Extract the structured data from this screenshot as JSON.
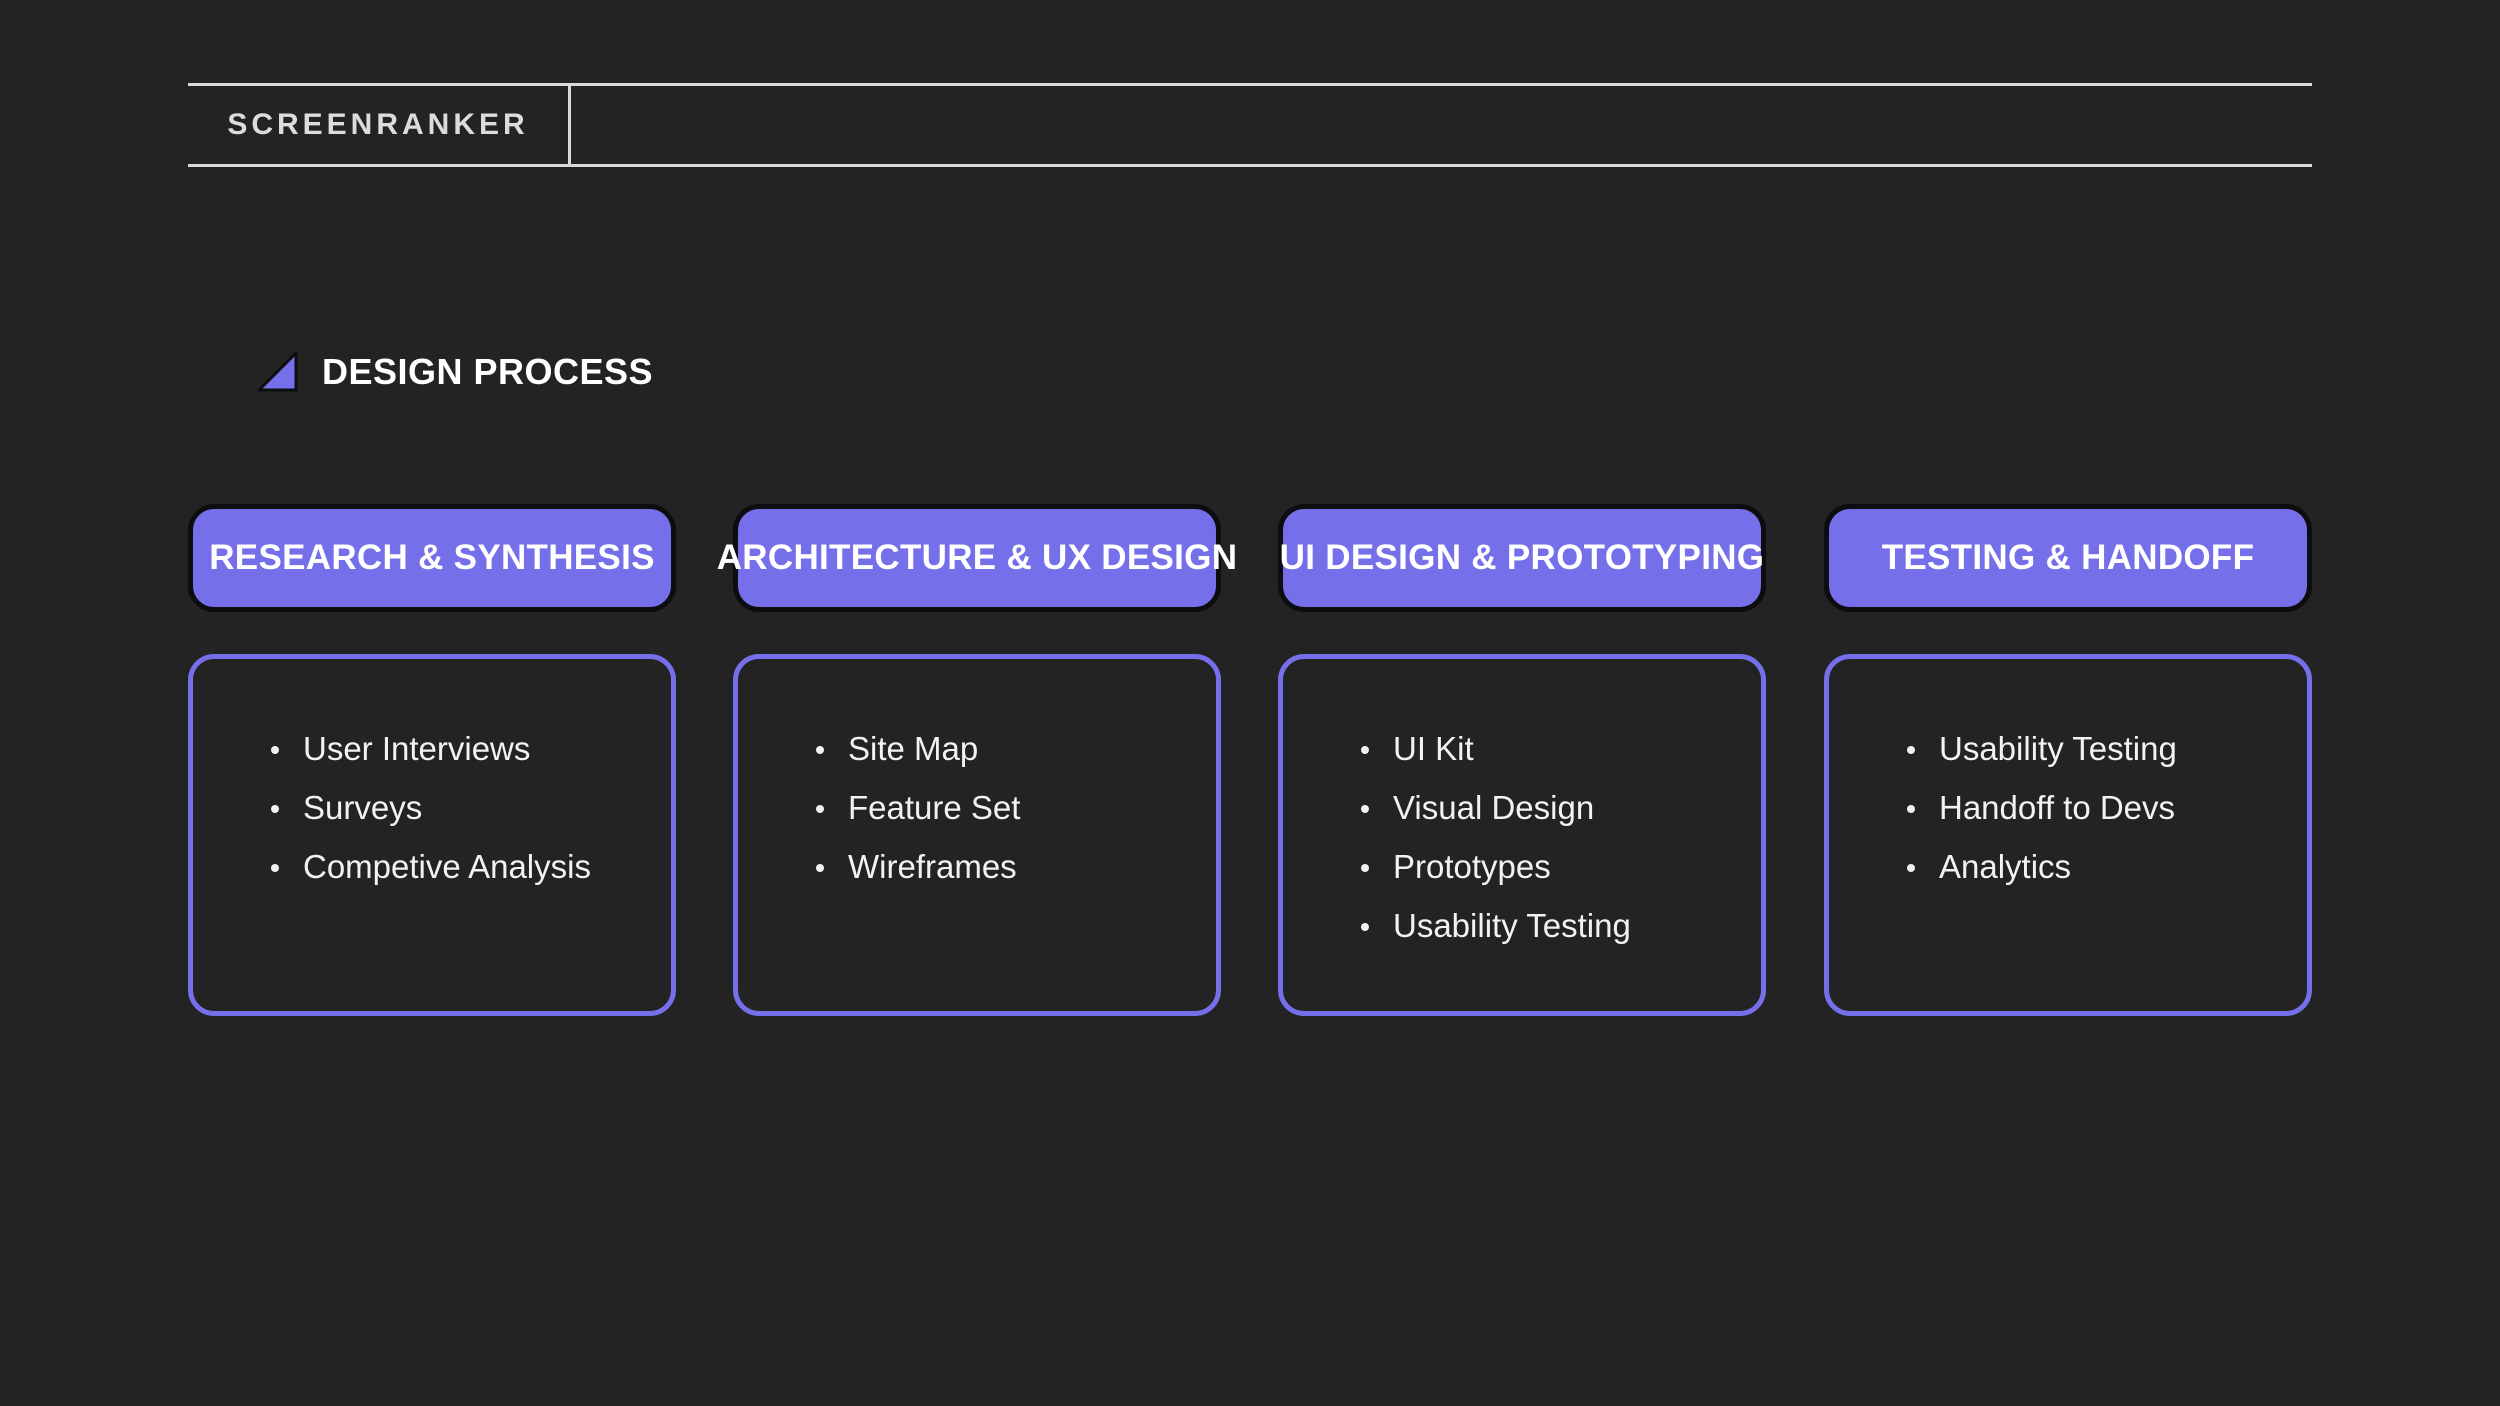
{
  "brand": {
    "name": "SCREENRANKER"
  },
  "section": {
    "title": "DESIGN PROCESS",
    "icon": "triangle-icon",
    "accent_color": "#7570ea"
  },
  "phases": [
    {
      "title": "RESEARCH & SYNTHESIS",
      "items": [
        "User Interviews",
        "Surveys",
        "Competive Analysis"
      ]
    },
    {
      "title": "ARCHITECTURE & UX DESIGN",
      "items": [
        "Site Map",
        "Feature Set",
        "Wireframes"
      ]
    },
    {
      "title": "UI DESIGN & PROTOTYPING",
      "items": [
        "UI Kit",
        "Visual Design",
        "Prototypes",
        "Usability Testing"
      ]
    },
    {
      "title": "TESTING & HANDOFF",
      "items": [
        "Usability Testing",
        "Handoff to Devs",
        "Analytics"
      ]
    }
  ]
}
